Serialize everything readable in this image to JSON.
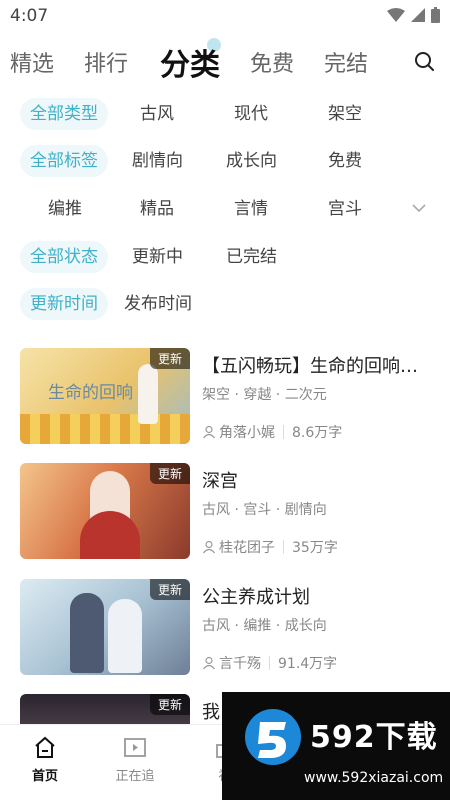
{
  "status": {
    "time": "4:07"
  },
  "tabs": [
    {
      "label": "精选",
      "active": false
    },
    {
      "label": "排行",
      "active": false
    },
    {
      "label": "分类",
      "active": true
    },
    {
      "label": "免费",
      "active": false
    },
    {
      "label": "完结",
      "active": false
    }
  ],
  "filters": {
    "type": [
      "全部类型",
      "古风",
      "现代",
      "架空"
    ],
    "tag_row1": [
      "全部标签",
      "剧情向",
      "成长向",
      "免费"
    ],
    "tag_row2": [
      "编推",
      "精品",
      "言情",
      "宫斗"
    ],
    "status": [
      "全部状态",
      "更新中",
      "已完结"
    ],
    "sort": [
      "更新时间",
      "发布时间"
    ]
  },
  "books": [
    {
      "badge": "更新",
      "title": "【五闪畅玩】生命的回响：...",
      "tags": "架空 · 穿越 · 二次元",
      "author": "角落小娓",
      "count": "8.6万字",
      "cover_colors": [
        "#f3d78a",
        "#e8b85a",
        "#8fb4c7"
      ],
      "cover_text": "生命的回响"
    },
    {
      "badge": "更新",
      "title": "深宫",
      "tags": "古风 · 宫斗 · 剧情向",
      "author": "桂花团子",
      "count": "35万字",
      "cover_colors": [
        "#f1b37a",
        "#c45a3a",
        "#7a2f2a"
      ],
      "cover_text": ""
    },
    {
      "badge": "更新",
      "title": "公主养成计划",
      "tags": "古风 · 编推 · 成长向",
      "author": "言千殇",
      "count": "91.4万字",
      "cover_colors": [
        "#cfe3ee",
        "#8fb1c8",
        "#6d7b93"
      ],
      "cover_text": ""
    },
    {
      "badge": "更新",
      "title": "我",
      "tags": "",
      "author": "",
      "count": "",
      "cover_colors": [
        "#3a2f3a",
        "#6a5a5e",
        "#a9958a"
      ],
      "cover_text": ""
    }
  ],
  "bottom_nav": [
    {
      "label": "首页",
      "active": true
    },
    {
      "label": "正在追",
      "active": false
    },
    {
      "label": "福",
      "active": false
    }
  ],
  "watermark": {
    "brand": "592下载",
    "url": "www.592xiazai.com"
  },
  "colors": {
    "accent": "#3fb1c9",
    "chip_bg": "#eef7f9"
  }
}
